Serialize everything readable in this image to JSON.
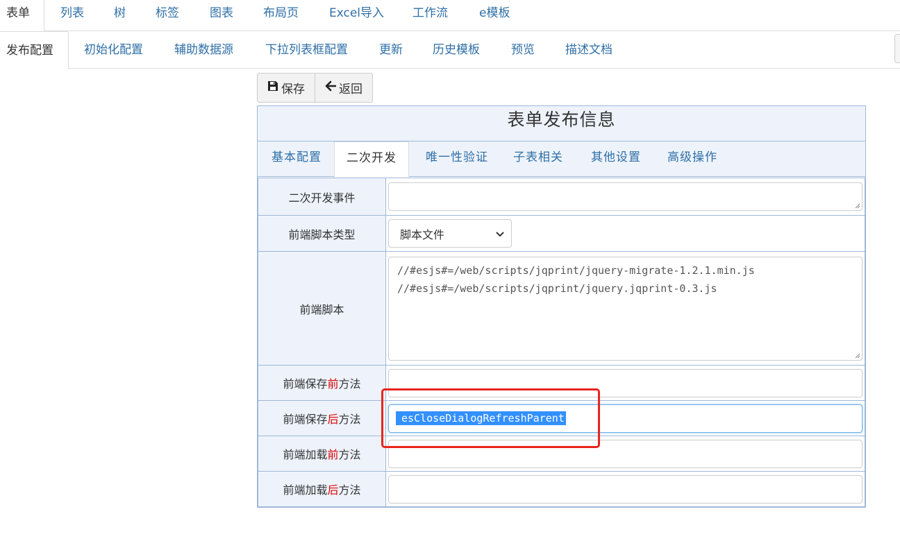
{
  "nav_primary": {
    "tabs": [
      "表单",
      "列表",
      "树",
      "标签",
      "图表",
      "布局页",
      "Excel导入",
      "工作流",
      "e模板"
    ],
    "active_index": 0
  },
  "nav_secondary": {
    "tabs": [
      "发布配置",
      "初始化配置",
      "辅助数据源",
      "下拉列表框配置",
      "更新",
      "历史模板",
      "预览",
      "描述文档"
    ],
    "active_index": 0
  },
  "toolbar": {
    "save_label": "保存",
    "back_label": "返回",
    "save_icon": "floppy-disk-icon",
    "back_icon": "arrow-left-icon"
  },
  "panel": {
    "title": "表单发布信息",
    "subtabs": [
      "基本配置",
      "二次开发",
      "唯一性验证",
      "子表相关",
      "其他设置",
      "高级操作"
    ],
    "active_subtab": 1
  },
  "form": {
    "event_label": "二次开发事件",
    "event_value": "",
    "script_type_label": "前端脚本类型",
    "script_type_value": "脚本文件",
    "script_label": "前端脚本",
    "script_lines": [
      "//#esjs#=/web/scripts/jqprint/jquery-migrate-1.2.1.min.js",
      "//#esjs#=/web/scripts/jqprint/jquery.jqprint-0.3.js"
    ],
    "before_save": {
      "prefix": "前端保存",
      "accent": "前",
      "suffix": "方法",
      "value": ""
    },
    "after_save": {
      "prefix": "前端保存",
      "accent": "后",
      "suffix": "方法",
      "value": "esCloseDialogRefreshParent"
    },
    "before_load": {
      "prefix": "前端加载",
      "accent": "前",
      "suffix": "方法",
      "value": ""
    },
    "after_load": {
      "prefix": "前端加载",
      "accent": "后",
      "suffix": "方法",
      "value": ""
    }
  },
  "colors": {
    "link": "#2f6fa7",
    "border": "#9fb7d8",
    "label_bg": "#eef3fb",
    "accent_red": "#dd0000",
    "selection": "#3390ff",
    "highlight": "#e8231d"
  }
}
